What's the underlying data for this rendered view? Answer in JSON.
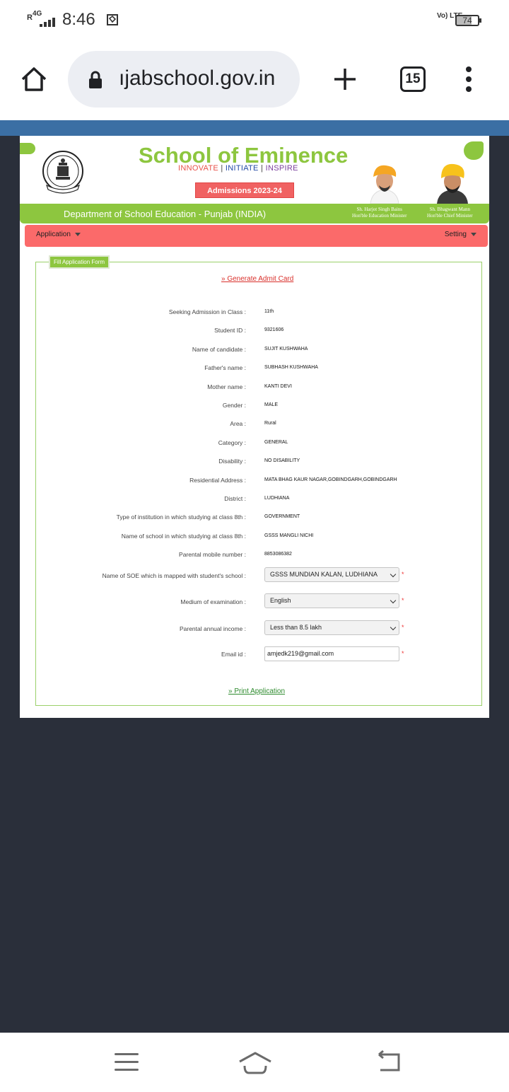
{
  "status_bar": {
    "network": "4G",
    "roaming": "R",
    "time": "8:46",
    "volte": "Vo) LTE",
    "battery": "74"
  },
  "browser": {
    "url": "ıjabschool.gov.in",
    "tab_count": "15"
  },
  "header": {
    "title": "School of Eminence",
    "tagline": {
      "innovate": "INNOVATE",
      "initiate": "INITIATE",
      "inspire": "INSPIRE",
      "separator": "|"
    },
    "admissions": "Admissions 2023-24",
    "department": "Department of School Education - Punjab (INDIA)",
    "minister_1": {
      "name": "Sh. Harjot Singh Bains",
      "role": "Hon'ble Education Minister"
    },
    "minister_2": {
      "name": "Sh. Bhagwant Mann",
      "role": "Hon'ble Chief Minister"
    }
  },
  "nav": {
    "application": "Application",
    "setting": "Setting"
  },
  "form": {
    "legend": "Fill Application Form",
    "generate_admit_card": "» Generate Admit Card",
    "print_application": "» Print Application",
    "rows": [
      {
        "label": "Seeking Admission in Class :",
        "value": "11th"
      },
      {
        "label": "Student ID :",
        "value": "9321606"
      },
      {
        "label": "Name of candidate :",
        "value": "SUJIT KUSHWAHA"
      },
      {
        "label": "Father's name :",
        "value": "SUBHASH KUSHWAHA"
      },
      {
        "label": "Mother name :",
        "value": "KANTI DEVI"
      },
      {
        "label": "Gender :",
        "value": "MALE"
      },
      {
        "label": "Area :",
        "value": "Rural"
      },
      {
        "label": "Category :",
        "value": "GENERAL"
      },
      {
        "label": "Disability :",
        "value": "NO DISABILITY"
      },
      {
        "label": "Residential Address :",
        "value": "MATA BHAG KAUR NAGAR,GOBINDGARH,GOBINDGARH"
      },
      {
        "label": "District :",
        "value": "LUDHIANA"
      },
      {
        "label": "Type of institution in which studying at class 8th :",
        "value": "GOVERNMENT"
      },
      {
        "label": "Name of school in which studying at class 8th :",
        "value": "GSSS MANGLI NICHI"
      },
      {
        "label": "Parental mobile number :",
        "value": "8853086382"
      }
    ],
    "soe": {
      "label": "Name of SOE which is mapped with student's school :",
      "value": "GSSS MUNDIAN KALAN, LUDHIANA"
    },
    "medium": {
      "label": "Medium of examination :",
      "value": "English"
    },
    "income": {
      "label": "Parental annual income :",
      "value": "Less than 8.5 lakh"
    },
    "email": {
      "label": "Email id :",
      "value": "amjedk219@gmail.com"
    },
    "required_mark": "*"
  },
  "colors": {
    "brand_green": "#8dc63f",
    "nav_red": "#fb6a6a",
    "page_bg": "#2a2f3a"
  }
}
